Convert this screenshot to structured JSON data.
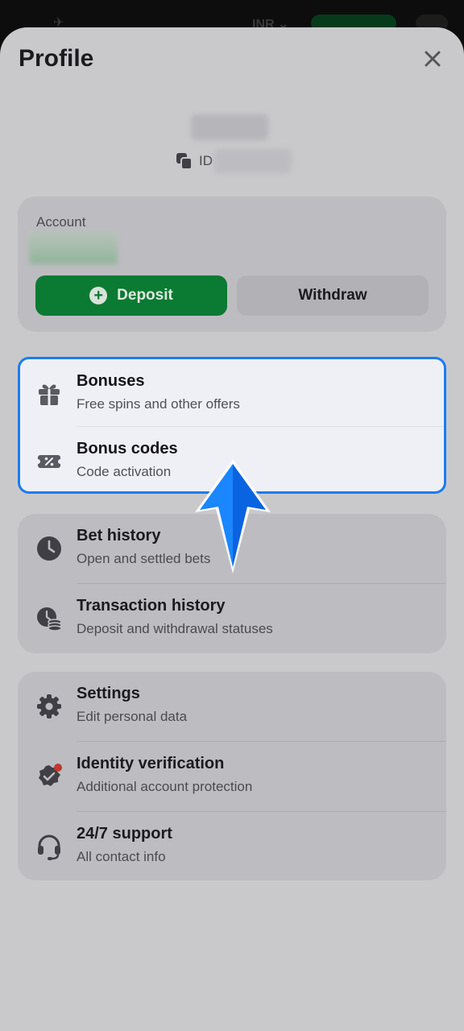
{
  "status_bar": {
    "currency": "INR"
  },
  "profile": {
    "title": "Profile",
    "id_label": "ID"
  },
  "account": {
    "label": "Account",
    "deposit_label": "Deposit",
    "withdraw_label": "Withdraw"
  },
  "menu_bonus": [
    {
      "title": "Bonuses",
      "subtitle": "Free spins and other offers",
      "icon": "gift-icon"
    },
    {
      "title": "Bonus codes",
      "subtitle": "Code activation",
      "icon": "coupon-icon"
    }
  ],
  "menu_history": [
    {
      "title": "Bet history",
      "subtitle": "Open and settled bets",
      "icon": "clock-icon"
    },
    {
      "title": "Transaction history",
      "subtitle": "Deposit and withdrawal statuses",
      "icon": "transaction-history-icon"
    }
  ],
  "menu_settings": [
    {
      "title": "Settings",
      "subtitle": "Edit personal data",
      "icon": "gear-icon"
    },
    {
      "title": "Identity verification",
      "subtitle": "Additional account protection",
      "icon": "verified-badge-icon"
    },
    {
      "title": "24/7 support",
      "subtitle": "All contact info",
      "icon": "headset-icon"
    }
  ],
  "colors": {
    "accent_green": "#0b7a32",
    "highlight_border": "#1a7cf0",
    "notification_dot": "#c0392b"
  }
}
